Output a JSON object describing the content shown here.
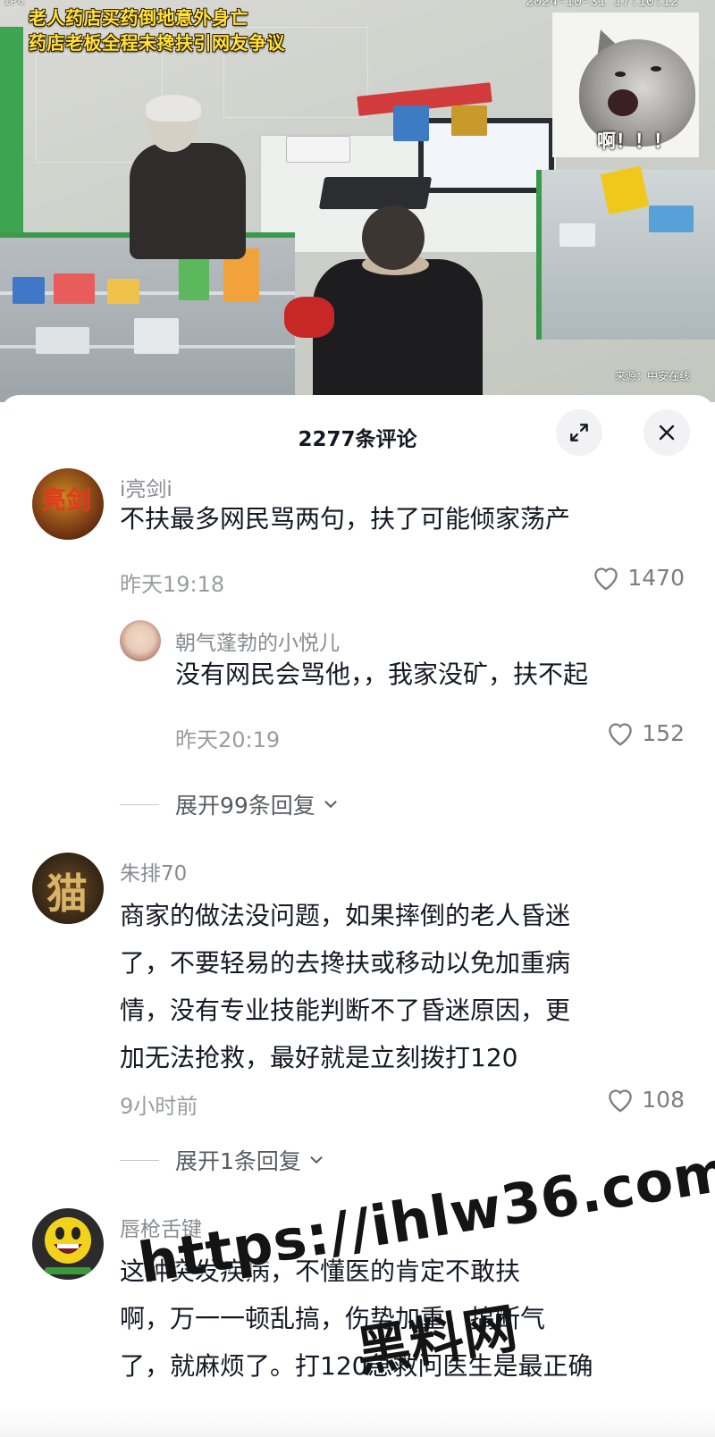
{
  "video": {
    "headline_line1": "老人药店买药倒地意外身亡",
    "headline_line2": "药店老板全程未搀扶引网友争议",
    "timestamp": "2024-10-31 17:10:12",
    "camera_label": "IPC",
    "cat_caption": "啊！！！",
    "source": "来源：中安在线"
  },
  "sheet": {
    "title": "2277条评论",
    "expand_icon": "expand-icon",
    "close_icon": "close-icon"
  },
  "comments": [
    {
      "username": "i亮剑i",
      "avatar_text": "亮剑",
      "avatar_color": "#7a3a14",
      "text": "不扶最多网民骂两句，扶了可能倾家荡产",
      "time": "昨天19:18",
      "likes": "1470"
    },
    {
      "username": "朝气蓬勃的小悦儿",
      "avatar_color": "#e7c9b7",
      "text": "没有网民会骂他，，我家没矿，扶不起",
      "time": "昨天20:19",
      "likes": "152",
      "is_reply": true
    },
    {
      "username": "朱排70",
      "avatar_text": "猫",
      "avatar_color": "#3b2a18",
      "text_lines": [
        "商家的做法没问题，如果摔倒的老人昏迷",
        "了，不要轻易的去搀扶或移动以免加重病",
        "情，没有专业技能判断不了昏迷原因，更",
        "加无法抢救，最好就是立刻拨打120"
      ],
      "time": "9小时前",
      "likes": "108"
    },
    {
      "username": "唇枪舌键",
      "avatar_color": "#2b2b2b",
      "text_lines": [
        "这种突发疾病，不懂医的肯定不敢扶",
        "啊，万一一顿乱搞，伤势加重，搞断气",
        "了，就麻烦了。打120急救问医生是最正确"
      ]
    }
  ],
  "expand_replies": [
    {
      "label": "展开99条回复"
    },
    {
      "label": "展开1条回复"
    }
  ],
  "watermark": {
    "line1": "https://ihlw36.com",
    "line2": "黑料网"
  },
  "colors": {
    "headline_yellow": "#ffe23a",
    "text_primary": "#161823",
    "text_secondary": "#8a8b91",
    "button_bg": "#f2f2f4"
  }
}
